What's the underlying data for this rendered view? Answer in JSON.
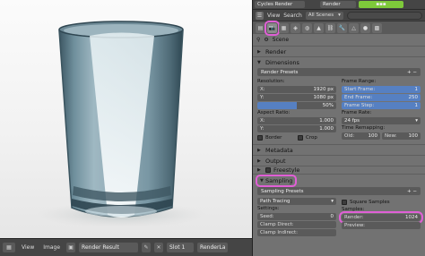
{
  "topbar": {
    "engine": "Cycles Render",
    "render_label": "Render",
    "accent": "#7ec93a"
  },
  "outliner": {
    "view_tab": "View",
    "search_tab": "Search",
    "scenes_dropdown": "All Scenes"
  },
  "properties_tabs": [
    "render-icon",
    "layers-icon",
    "scene-icon",
    "world-icon",
    "object-icon",
    "constraints-icon",
    "modifiers-icon",
    "data-icon",
    "material-icon",
    "texture-icon"
  ],
  "breadcrumb": {
    "scene": "Scene"
  },
  "panels": {
    "render": "Render",
    "dimensions": "Dimensions",
    "metadata": "Metadata",
    "output": "Output",
    "freestyle": "Freestyle",
    "sampling": "Sampling"
  },
  "dimensions": {
    "presets": "Render Presets",
    "resolution_label": "Resolution:",
    "res_x_label": "X:",
    "res_x": "1920 px",
    "res_y_label": "Y:",
    "res_y": "1080 px",
    "res_percent": "50%",
    "res_percent_value": 0.5,
    "aspect_label": "Aspect Ratio:",
    "aspect_x_label": "X:",
    "aspect_x": "1.000",
    "aspect_y_label": "Y:",
    "aspect_y": "1.000",
    "border": "Border",
    "crop": "Crop",
    "frame_range_label": "Frame Range:",
    "start_label": "Start Frame:",
    "start": "1",
    "end_label": "End Frame:",
    "end": "250",
    "step_label": "Frame Step:",
    "step": "1",
    "frame_rate_label": "Frame Rate:",
    "fps": "24 fps",
    "time_remap_label": "Time Remapping:",
    "old_label": "Old:",
    "old": "100",
    "new_label": "New:",
    "new": "100"
  },
  "sampling": {
    "presets": "Sampling Presets",
    "integrator": "Path Tracing",
    "square_samples": "Square Samples",
    "settings_label": "Settings:",
    "seed_label": "Seed:",
    "seed": "0",
    "clamp_direct_label": "Clamp Direct:",
    "clamp_indirect_label": "Clamp Indirect:",
    "samples_label": "Samples:",
    "render_label": "Render:",
    "render_samples": "1024",
    "preview_label": "Preview:"
  },
  "image_editor_footer": {
    "view": "View",
    "image": "Image",
    "image_name": "Render Result",
    "slot": "Slot 1",
    "layer": "RenderLa"
  }
}
